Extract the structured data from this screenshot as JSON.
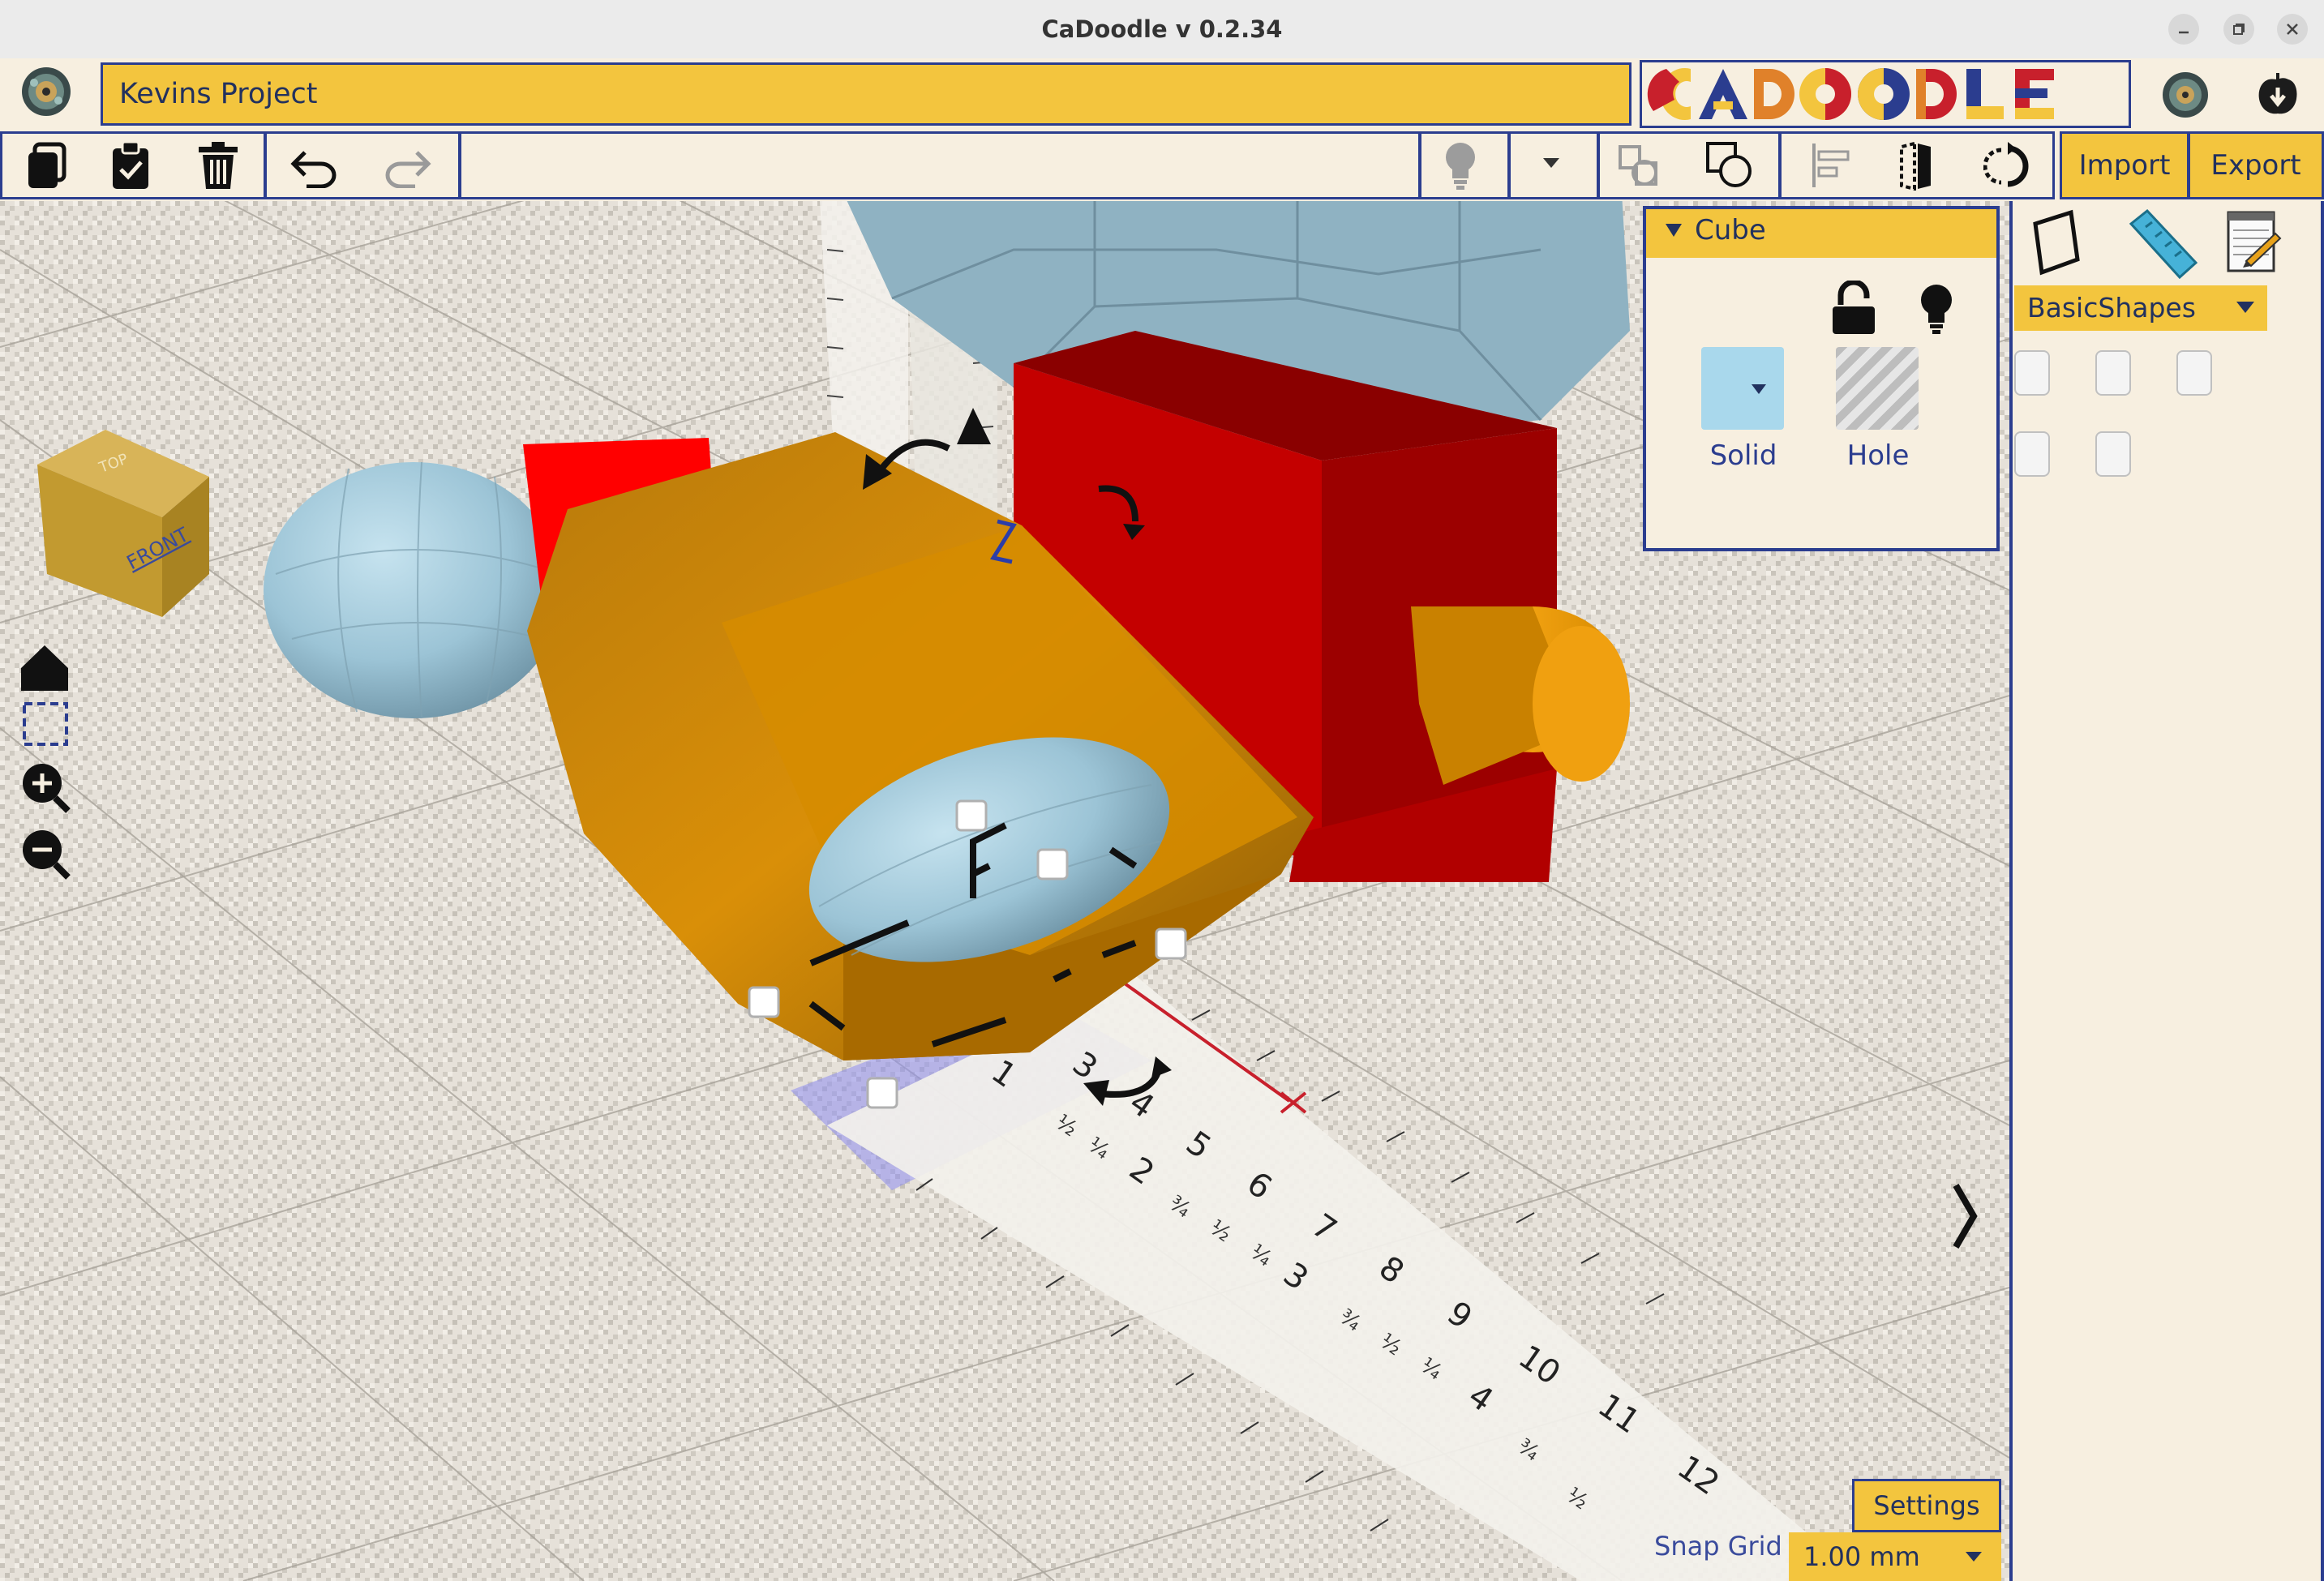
{
  "window": {
    "title": "CaDoodle v 0.2.34",
    "controls": [
      "minimize",
      "maximize",
      "close"
    ]
  },
  "header": {
    "project_name": "Kevins Project",
    "logo_text": "CADOODLE"
  },
  "toolbar": {
    "import_label": "Import",
    "export_label": "Export"
  },
  "properties_panel": {
    "title": "Cube",
    "solid_label": "Solid",
    "hole_label": "Hole"
  },
  "shapes_panel": {
    "category": "BasicShapes"
  },
  "bottom": {
    "settings_label": "Settings",
    "snap_grid_label": "Snap Grid",
    "snap_grid_value": "1.00 mm"
  },
  "ruler": {
    "cm_labels": [
      "3",
      "4",
      "5",
      "6",
      "7",
      "8",
      "9",
      "10",
      "11",
      "12"
    ],
    "inch_labels": [
      "1",
      "2",
      "3",
      "4"
    ],
    "fraction_labels": [
      "½",
      "¼",
      "¾"
    ]
  },
  "colors": {
    "accent_yellow": "#f3c53e",
    "panel_border": "#2b3d8f",
    "background": "#f7efe0",
    "solid_swatch": "#a9d8ec"
  }
}
